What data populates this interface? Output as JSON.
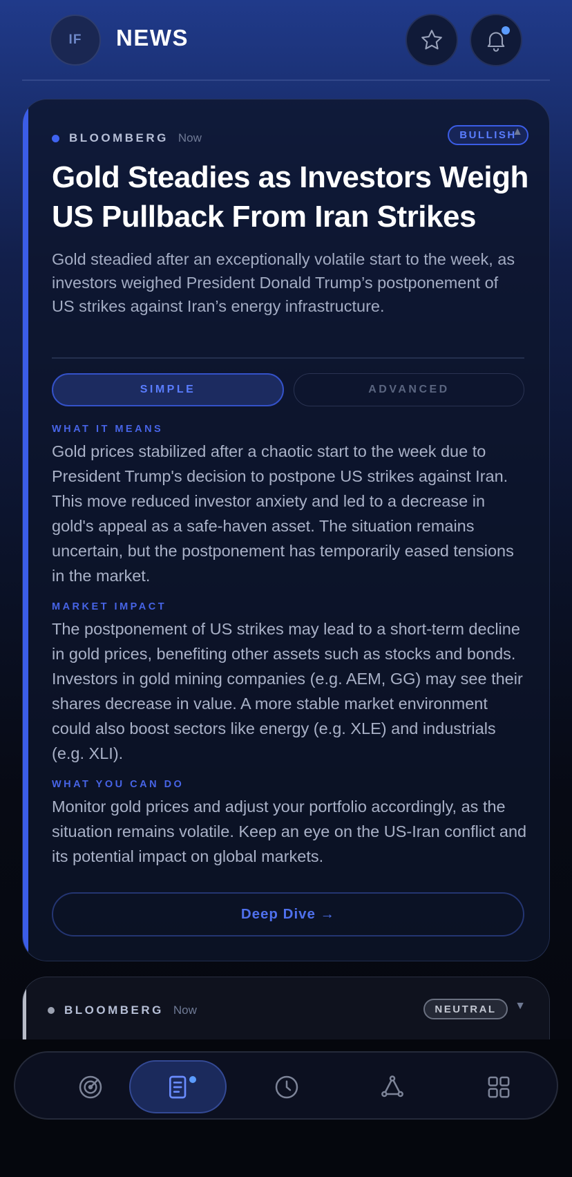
{
  "header": {
    "avatar_initials": "IF",
    "title": "NEWS",
    "favorites_icon": "star-icon",
    "notifications_icon": "bell-icon",
    "has_notification": true
  },
  "articles": [
    {
      "source": "BLOOMBERG",
      "time": "Now",
      "sentiment": "BULLISH",
      "expanded": true,
      "title": "Gold Steadies as Investors Weigh US Pullback From Iran Strikes",
      "summary": "Gold steadied after an exceptionally volatile start to the week, as investors weighed President Donald Trump’s postponement of US strikes against Iran’s energy infrastructure.",
      "tabs": [
        "SIMPLE",
        "ADVANCED"
      ],
      "active_tab": "SIMPLE",
      "sections": [
        {
          "label": "WHAT IT MEANS",
          "body": "Gold prices stabilized after a chaotic start to the week due to President Trump's decision to postpone US strikes against Iran. This move reduced investor anxiety and led to a decrease in gold's appeal as a safe-haven asset. The situation remains uncertain, but the postponement has temporarily eased tensions in the market."
        },
        {
          "label": "MARKET IMPACT",
          "body": "The postponement of US strikes may lead to a short-term decline in gold prices, benefiting other assets such as stocks and bonds. Investors in gold mining companies (e.g. AEM, GG) may see their shares decrease in value. A more stable market environment could also boost sectors like energy (e.g. XLE) and industrials (e.g. XLI)."
        },
        {
          "label": "WHAT YOU CAN DO",
          "body": "Monitor gold prices and adjust your portfolio accordingly, as the situation remains volatile. Keep an eye on the US-Iran conflict and its potential impact on global markets."
        }
      ],
      "cta": "Deep Dive →"
    },
    {
      "source": "BLOOMBERG",
      "time": "Now",
      "sentiment": "NEUTRAL",
      "expanded": false
    }
  ],
  "nav": {
    "items": [
      {
        "icon": "radar-icon",
        "active": false
      },
      {
        "icon": "news-icon",
        "active": true
      },
      {
        "icon": "clock-icon",
        "active": false
      },
      {
        "icon": "network-icon",
        "active": false
      },
      {
        "icon": "grid-icon",
        "active": false
      }
    ]
  },
  "colors": {
    "accent": "#3b5de7",
    "bullish": "#5a7dff",
    "neutral": "#c3c7d2",
    "notification_dot": "#5b9cff"
  }
}
